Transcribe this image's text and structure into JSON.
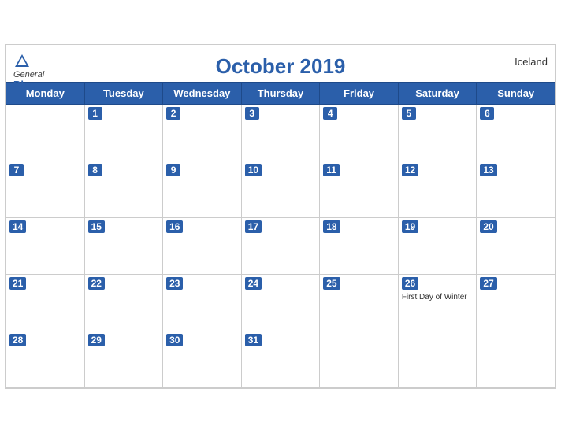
{
  "header": {
    "title": "October 2019",
    "country": "Iceland",
    "logo_general": "General",
    "logo_blue": "Blue"
  },
  "days_of_week": [
    "Monday",
    "Tuesday",
    "Wednesday",
    "Thursday",
    "Friday",
    "Saturday",
    "Sunday"
  ],
  "weeks": [
    [
      {
        "day": null,
        "event": ""
      },
      {
        "day": 1,
        "event": ""
      },
      {
        "day": 2,
        "event": ""
      },
      {
        "day": 3,
        "event": ""
      },
      {
        "day": 4,
        "event": ""
      },
      {
        "day": 5,
        "event": ""
      },
      {
        "day": 6,
        "event": ""
      }
    ],
    [
      {
        "day": 7,
        "event": ""
      },
      {
        "day": 8,
        "event": ""
      },
      {
        "day": 9,
        "event": ""
      },
      {
        "day": 10,
        "event": ""
      },
      {
        "day": 11,
        "event": ""
      },
      {
        "day": 12,
        "event": ""
      },
      {
        "day": 13,
        "event": ""
      }
    ],
    [
      {
        "day": 14,
        "event": ""
      },
      {
        "day": 15,
        "event": ""
      },
      {
        "day": 16,
        "event": ""
      },
      {
        "day": 17,
        "event": ""
      },
      {
        "day": 18,
        "event": ""
      },
      {
        "day": 19,
        "event": ""
      },
      {
        "day": 20,
        "event": ""
      }
    ],
    [
      {
        "day": 21,
        "event": ""
      },
      {
        "day": 22,
        "event": ""
      },
      {
        "day": 23,
        "event": ""
      },
      {
        "day": 24,
        "event": ""
      },
      {
        "day": 25,
        "event": ""
      },
      {
        "day": 26,
        "event": "First Day of Winter"
      },
      {
        "day": 27,
        "event": ""
      }
    ],
    [
      {
        "day": 28,
        "event": ""
      },
      {
        "day": 29,
        "event": ""
      },
      {
        "day": 30,
        "event": ""
      },
      {
        "day": 31,
        "event": ""
      },
      {
        "day": null,
        "event": ""
      },
      {
        "day": null,
        "event": ""
      },
      {
        "day": null,
        "event": ""
      }
    ]
  ],
  "colors": {
    "header_bg": "#2b5faa",
    "header_text": "#ffffff",
    "title_color": "#2b5faa"
  }
}
